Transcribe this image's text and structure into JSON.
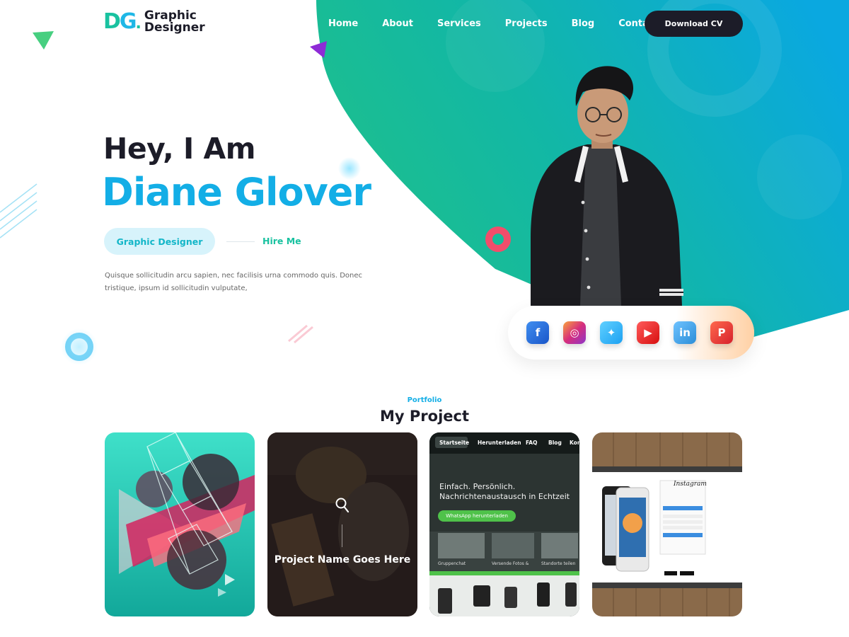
{
  "brand": {
    "mark_d": "D",
    "mark_g": "G",
    "mark_dot": ".",
    "line1": "Graphic",
    "line2": "Designer"
  },
  "nav": {
    "items": [
      "Home",
      "About",
      "Services",
      "Projects",
      "Blog",
      "Contact"
    ],
    "cta": "Download CV"
  },
  "hero": {
    "greeting": "Hey, I Am",
    "name": "Diane Glover",
    "role": "Graphic Designer",
    "hire": "Hire Me",
    "description": "Quisque sollicitudin arcu sapien, nec facilisis urna commodo quis. Donec tristique, ipsum id sollicitudin vulputate,"
  },
  "social": {
    "items": [
      {
        "name": "facebook-icon",
        "glyph": "f"
      },
      {
        "name": "instagram-icon",
        "glyph": "◎"
      },
      {
        "name": "twitter-icon",
        "glyph": "✦"
      },
      {
        "name": "youtube-icon",
        "glyph": "▶"
      },
      {
        "name": "linkedin-icon",
        "glyph": "in"
      },
      {
        "name": "pinterest-icon",
        "glyph": "P"
      }
    ]
  },
  "portfolio": {
    "eyebrow": "Portfolio",
    "title": "My Project",
    "hover_title": "Project Name Goes Here",
    "card3": {
      "tabs": [
        "Startseite",
        "Herunterladen",
        "FAQ",
        "Blog",
        "Kon"
      ],
      "headline_1": "Einfach. Persönlich.",
      "headline_2": "Nachrichtenaustausch in Echtzeit",
      "button": "WhatsApp herunterladen",
      "captions": [
        "Gruppenchat",
        "Versende Fotos &",
        "Standorte teilen"
      ]
    },
    "card4": {
      "app_title": "Instagram"
    }
  },
  "colors": {
    "accent_blue": "#13aee6",
    "accent_green": "#19c2a0",
    "dark": "#1c1c28"
  }
}
